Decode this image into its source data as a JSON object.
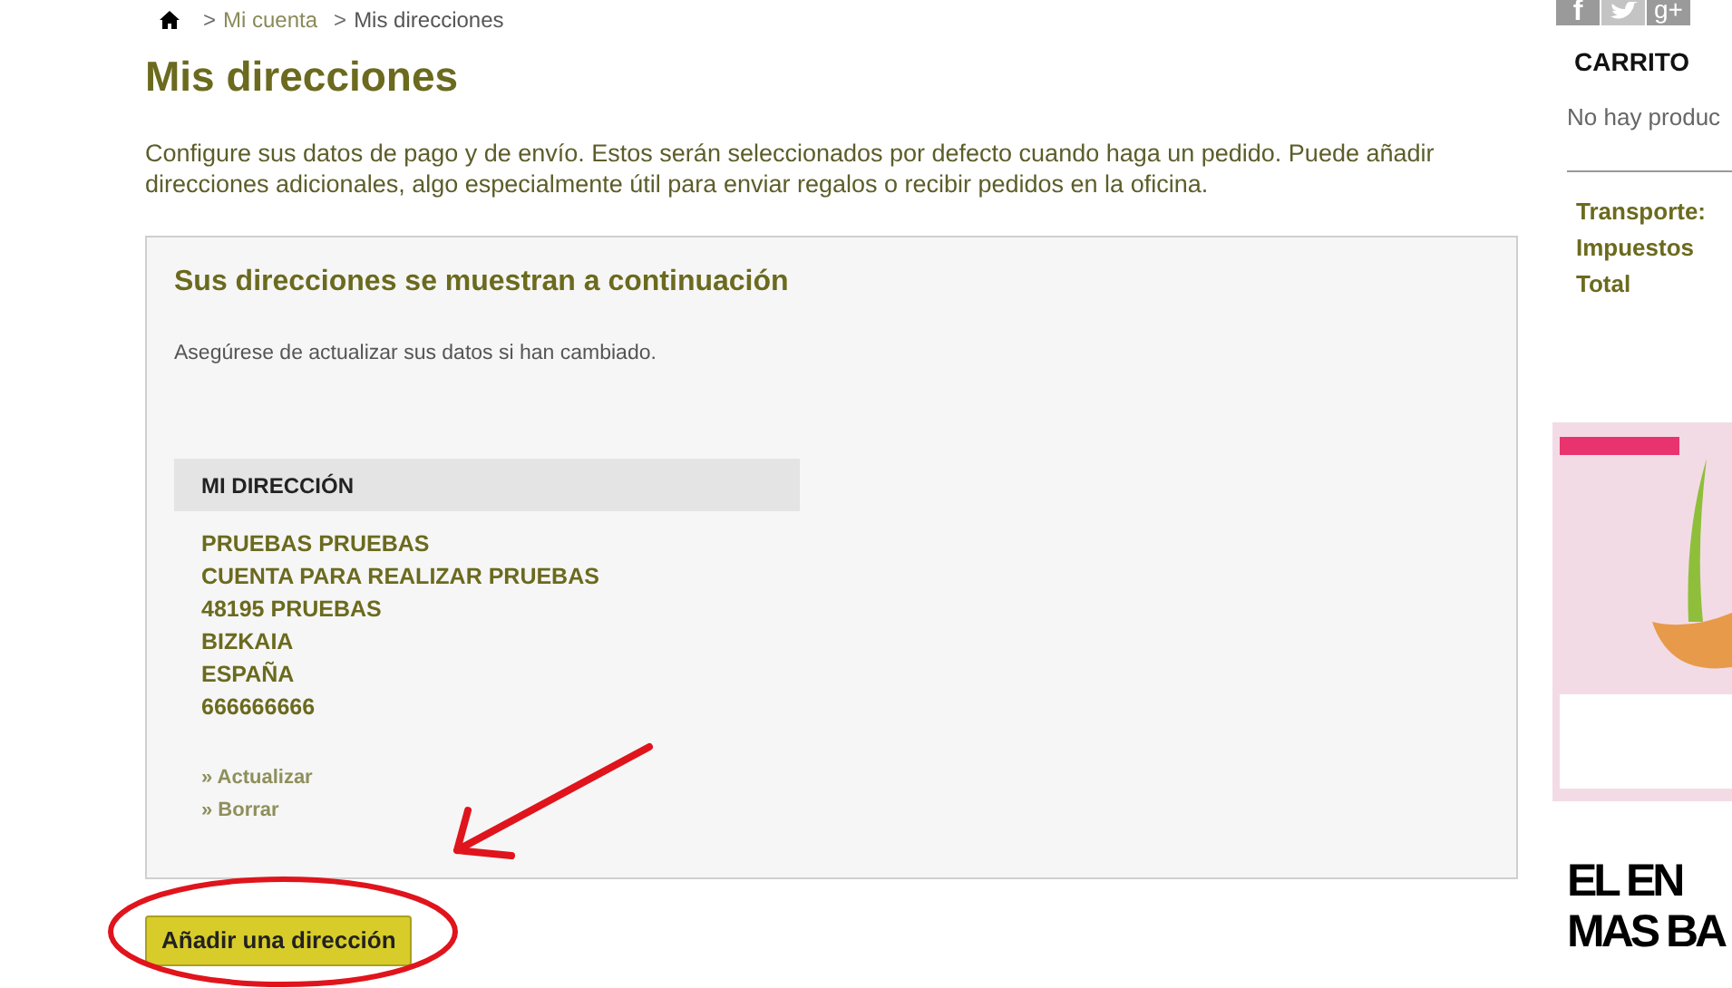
{
  "breadcrumb": {
    "items": [
      "Mi cuenta",
      "Mis direcciones"
    ],
    "separator": ">"
  },
  "page": {
    "title": "Mis direcciones",
    "intro": "Configure sus datos de pago y de envío. Estos serán seleccionados por defecto cuando haga un pedido. Puede añadir direcciones adicionales, algo especialmente útil para enviar regalos o recibir pedidos en la oficina."
  },
  "addresses_panel": {
    "heading": "Sus direcciones se muestran a continuación",
    "note": "Asegúrese de actualizar sus datos si han cambiado.",
    "address": {
      "title": "MI DIRECCIÓN",
      "lines": [
        "PRUEBAS PRUEBAS",
        "CUENTA PARA REALIZAR PRUEBAS",
        "48195 PRUEBAS",
        "BIZKAIA",
        "ESPAÑA",
        "666666666"
      ],
      "actions": [
        "» Actualizar",
        "» Borrar"
      ]
    }
  },
  "add_button": "Añadir una dirección",
  "sidebar": {
    "social": [
      {
        "kind": "facebook",
        "label": "f"
      },
      {
        "kind": "twitter"
      },
      {
        "kind": "google",
        "label": "g+"
      }
    ],
    "cart": {
      "title": "CARRITO",
      "empty": "No hay produc",
      "totals": [
        "Transporte:",
        "Impuestos",
        "Total"
      ]
    },
    "banner_headline": [
      "EL EN",
      "MAS BA"
    ]
  }
}
